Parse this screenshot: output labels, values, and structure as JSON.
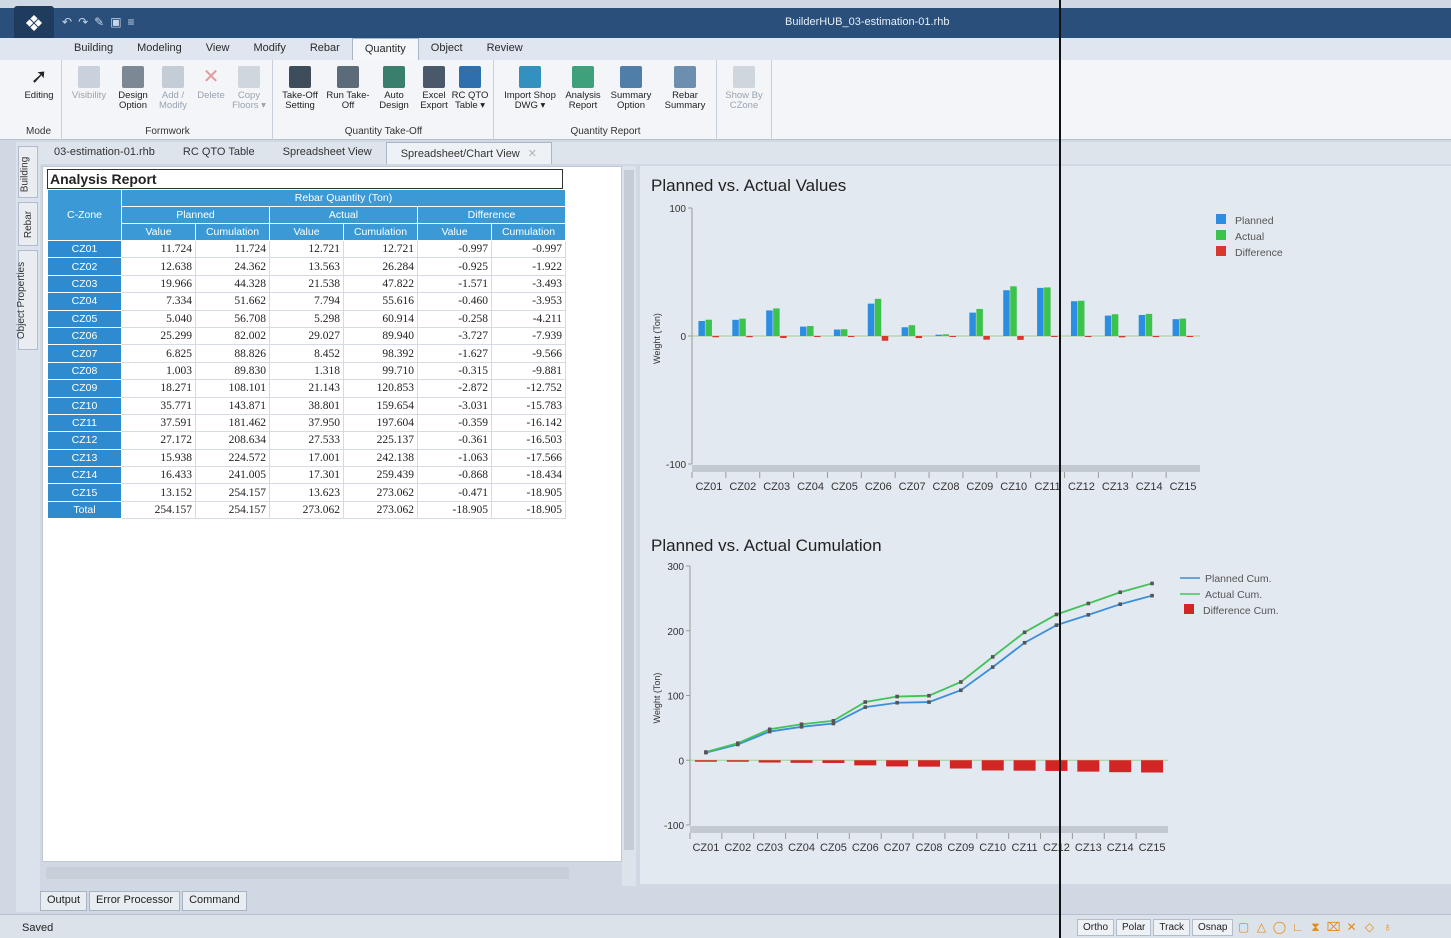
{
  "titlebar": {
    "title": "BuilderHUB_03-estimation-01.rhb"
  },
  "ribbon_tabs": [
    "Building",
    "Modeling",
    "View",
    "Modify",
    "Rebar",
    "Quantity",
    "Object",
    "Review"
  ],
  "ribbon_active": "Quantity",
  "ribbon": {
    "mode_group": {
      "label": "Mode",
      "buttons": [
        {
          "label": "Editing",
          "icon": "cursor-icon"
        }
      ]
    },
    "formwork_group": {
      "label": "Formwork",
      "buttons": [
        {
          "label": "Visibility",
          "icon": "visibility-icon"
        },
        {
          "label": "Design Option",
          "icon": "design-option-icon"
        },
        {
          "label": "Add / Modify",
          "icon": "add-modify-icon"
        },
        {
          "label": "Delete",
          "icon": "delete-icon"
        },
        {
          "label": "Copy Floors ▾",
          "icon": "copy-floors-icon"
        }
      ]
    },
    "takeoff_group": {
      "label": "Quantity Take-Off",
      "buttons": [
        {
          "label": "Take-Off Setting",
          "icon": "takeoff-setting-icon"
        },
        {
          "label": "Run Take-Off",
          "icon": "run-takeoff-icon"
        },
        {
          "label": "Auto Design",
          "icon": "auto-design-icon"
        },
        {
          "label": "Excel Export",
          "icon": "excel-export-icon"
        },
        {
          "label": "RC QTO Table ▾",
          "icon": "rc-qto-table-icon"
        }
      ]
    },
    "report_group": {
      "label": "Quantity Report",
      "buttons": [
        {
          "label": "Import Shop DWG ▾",
          "icon": "import-shop-dwg-icon"
        },
        {
          "label": "Analysis Report",
          "icon": "analysis-report-icon"
        },
        {
          "label": "Summary Option",
          "icon": "summary-option-icon"
        },
        {
          "label": "Rebar Summary",
          "icon": "rebar-summary-icon"
        },
        {
          "label": "Show By CZone",
          "icon": "show-by-czone-icon"
        }
      ]
    }
  },
  "side_tabs": [
    "Building",
    "Rebar",
    "Object Properties"
  ],
  "doc_tabs": [
    "03-estimation-01.rhb",
    "RC QTO Table",
    "Spreadsheet View",
    "Spreadsheet/Chart View"
  ],
  "doc_tab_active": "Spreadsheet/Chart View",
  "report": {
    "title": "Analysis Report",
    "header_group": "Rebar Quantity (Ton)",
    "zone_header": "C-Zone",
    "groups": [
      "Planned",
      "Actual",
      "Difference"
    ],
    "subheaders": [
      "Value",
      "Cumulation",
      "Value",
      "Cumulation",
      "Value",
      "Cumulation"
    ],
    "rows": [
      [
        "CZ01",
        "11.724",
        "11.724",
        "12.721",
        "12.721",
        "-0.997",
        "-0.997"
      ],
      [
        "CZ02",
        "12.638",
        "24.362",
        "13.563",
        "26.284",
        "-0.925",
        "-1.922"
      ],
      [
        "CZ03",
        "19.966",
        "44.328",
        "21.538",
        "47.822",
        "-1.571",
        "-3.493"
      ],
      [
        "CZ04",
        "7.334",
        "51.662",
        "7.794",
        "55.616",
        "-0.460",
        "-3.953"
      ],
      [
        "CZ05",
        "5.040",
        "56.708",
        "5.298",
        "60.914",
        "-0.258",
        "-4.211"
      ],
      [
        "CZ06",
        "25.299",
        "82.002",
        "29.027",
        "89.940",
        "-3.727",
        "-7.939"
      ],
      [
        "CZ07",
        "6.825",
        "88.826",
        "8.452",
        "98.392",
        "-1.627",
        "-9.566"
      ],
      [
        "CZ08",
        "1.003",
        "89.830",
        "1.318",
        "99.710",
        "-0.315",
        "-9.881"
      ],
      [
        "CZ09",
        "18.271",
        "108.101",
        "21.143",
        "120.853",
        "-2.872",
        "-12.752"
      ],
      [
        "CZ10",
        "35.771",
        "143.871",
        "38.801",
        "159.654",
        "-3.031",
        "-15.783"
      ],
      [
        "CZ11",
        "37.591",
        "181.462",
        "37.950",
        "197.604",
        "-0.359",
        "-16.142"
      ],
      [
        "CZ12",
        "27.172",
        "208.634",
        "27.533",
        "225.137",
        "-0.361",
        "-16.503"
      ],
      [
        "CZ13",
        "15.938",
        "224.572",
        "17.001",
        "242.138",
        "-1.063",
        "-17.566"
      ],
      [
        "CZ14",
        "16.433",
        "241.005",
        "17.301",
        "259.439",
        "-0.868",
        "-18.434"
      ],
      [
        "CZ15",
        "13.152",
        "254.157",
        "13.623",
        "273.062",
        "-0.471",
        "-18.905"
      ],
      [
        "Total",
        "254.157",
        "254.157",
        "273.062",
        "273.062",
        "-18.905",
        "-18.905"
      ]
    ]
  },
  "chart_data": [
    {
      "type": "bar",
      "title": "Planned vs. Actual Values",
      "ylabel": "Weight (Ton)",
      "ylim": [
        -100,
        100
      ],
      "yticks": [
        "100",
        "0",
        "-100"
      ],
      "categories": [
        "CZ01",
        "CZ02",
        "CZ03",
        "CZ04",
        "CZ05",
        "CZ06",
        "CZ07",
        "CZ08",
        "CZ09",
        "CZ10",
        "CZ11",
        "CZ12",
        "CZ13",
        "CZ14",
        "CZ15"
      ],
      "series": [
        {
          "name": "Planned",
          "color": "#2b8ee0",
          "values": [
            11.724,
            12.638,
            19.966,
            7.334,
            5.04,
            25.299,
            6.825,
            1.003,
            18.271,
            35.771,
            37.591,
            27.172,
            15.938,
            16.433,
            13.152
          ]
        },
        {
          "name": "Actual",
          "color": "#3cc34c",
          "values": [
            12.721,
            13.563,
            21.538,
            7.794,
            5.298,
            29.027,
            8.452,
            1.318,
            21.143,
            38.801,
            37.95,
            27.533,
            17.001,
            17.301,
            13.623
          ]
        },
        {
          "name": "Difference",
          "color": "#d63a2e",
          "values": [
            -0.997,
            -0.925,
            -1.571,
            -0.46,
            -0.258,
            -3.727,
            -1.627,
            -0.315,
            -2.872,
            -3.031,
            -0.359,
            -0.361,
            -1.063,
            -0.868,
            -0.471
          ]
        }
      ],
      "legend": "top-right"
    },
    {
      "type": "line",
      "title": "Planned vs. Actual Cumulation",
      "ylabel": "Weight (Ton)",
      "ylim": [
        -100,
        300
      ],
      "yticks": [
        "300",
        "200",
        "100",
        "0",
        "-100"
      ],
      "categories": [
        "CZ01",
        "CZ02",
        "CZ03",
        "CZ04",
        "CZ05",
        "CZ06",
        "CZ07",
        "CZ08",
        "CZ09",
        "CZ10",
        "CZ11",
        "CZ12",
        "CZ13",
        "CZ14",
        "CZ15"
      ],
      "series": [
        {
          "name": "Planned Cum.",
          "color": "#3b8fd8",
          "values": [
            11.724,
            24.362,
            44.328,
            51.662,
            56.708,
            82.002,
            88.826,
            89.83,
            108.101,
            143.871,
            181.462,
            208.634,
            224.572,
            241.005,
            254.157
          ]
        },
        {
          "name": "Actual Cum.",
          "color": "#44c25a",
          "values": [
            12.721,
            26.284,
            47.822,
            55.616,
            60.914,
            89.94,
            98.392,
            99.71,
            120.853,
            159.654,
            197.604,
            225.137,
            242.138,
            259.439,
            273.062
          ]
        },
        {
          "name": "Difference Cum.",
          "color": "#d22525",
          "values": [
            -0.997,
            -1.922,
            -3.493,
            -3.953,
            -4.211,
            -7.939,
            -9.566,
            -9.881,
            -12.752,
            -15.783,
            -16.142,
            -16.503,
            -17.566,
            -18.434,
            -18.905
          ]
        }
      ],
      "legend": "top-right"
    }
  ],
  "output_tabs": [
    "Output",
    "Error Processor",
    "Command"
  ],
  "status": {
    "text": "Saved",
    "snap_buttons": [
      "Ortho",
      "Polar",
      "Track",
      "Osnap"
    ]
  }
}
